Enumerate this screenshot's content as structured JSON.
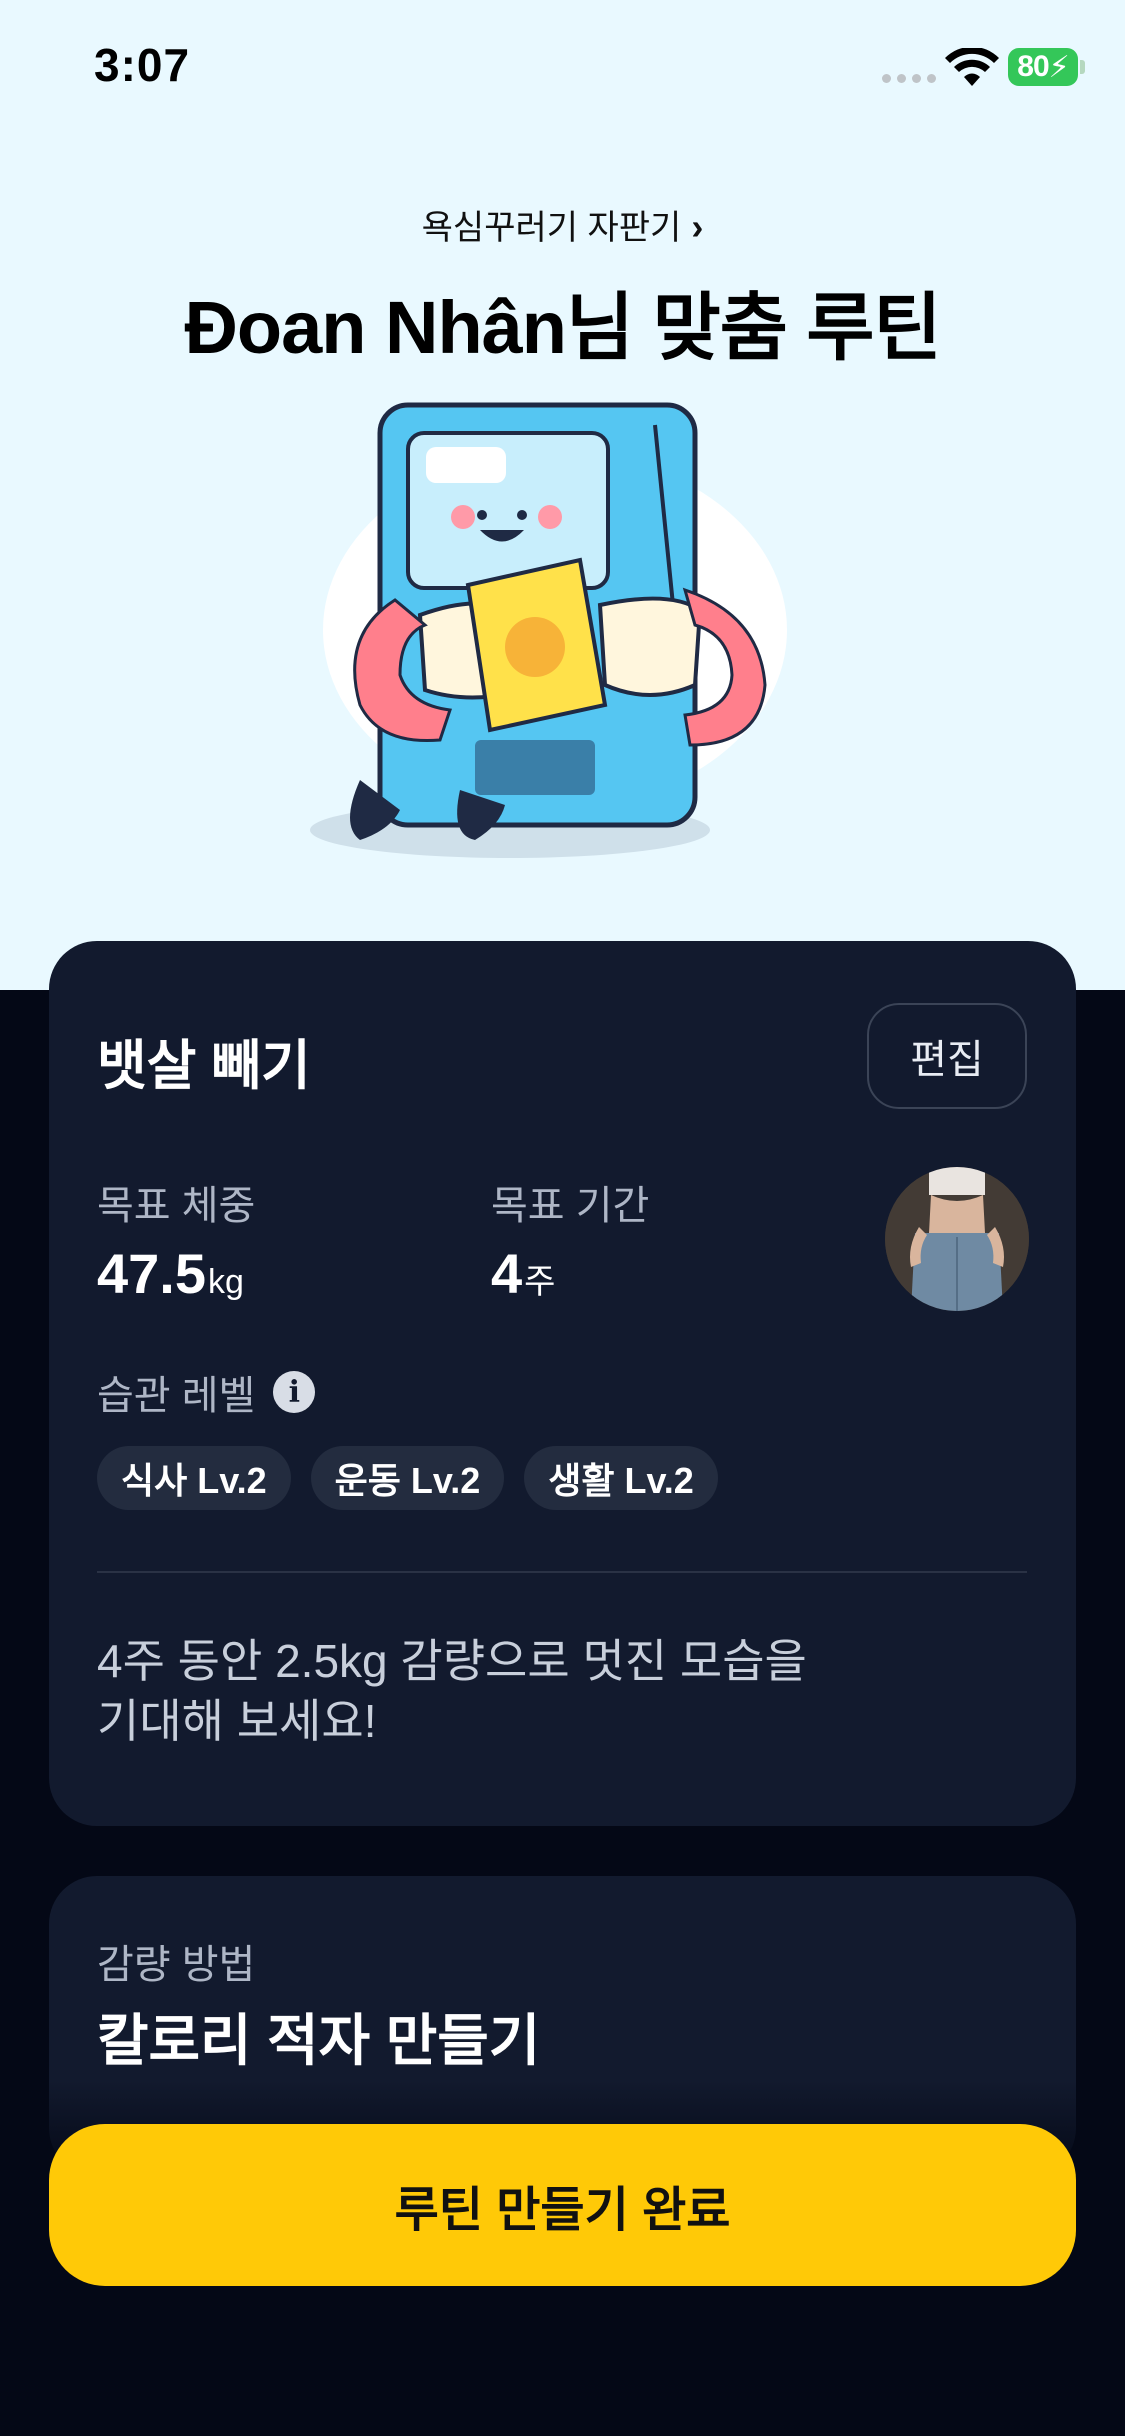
{
  "status_bar": {
    "time": "3:07",
    "battery": "80",
    "icons": [
      "signal-dots-icon",
      "wifi-icon",
      "battery-charging-icon"
    ]
  },
  "header": {
    "link_text": "욕심꾸러기 자판기",
    "title": "Đoan Nhân님 맞춤 루틴"
  },
  "routine_card": {
    "title": "뱃살 빼기",
    "edit_label": "편집",
    "target_weight": {
      "label": "목표 체중",
      "value": "47.5",
      "unit": "kg"
    },
    "target_period": {
      "label": "목표 기간",
      "value": "4",
      "unit": "주"
    },
    "habit_level_label": "습관 레벨",
    "chips": [
      {
        "label": "식사 Lv.2"
      },
      {
        "label": "운동 Lv.2"
      },
      {
        "label": "생활 Lv.2"
      }
    ],
    "description_line1": "4주 동안 2.5kg 감량으로 멋진 모습을",
    "description_line2": "기대해 보세요!"
  },
  "method_card": {
    "label": "감량 방법",
    "title": "칼로리 적자 만들기"
  },
  "cta": {
    "label": "루틴 만들기 완료"
  },
  "colors": {
    "top_background": "#e9f9ff",
    "page_background": "#040816",
    "card": "#121a2e",
    "chip": "#232c3f",
    "cta": "#ffc907",
    "battery": "#34c759"
  }
}
